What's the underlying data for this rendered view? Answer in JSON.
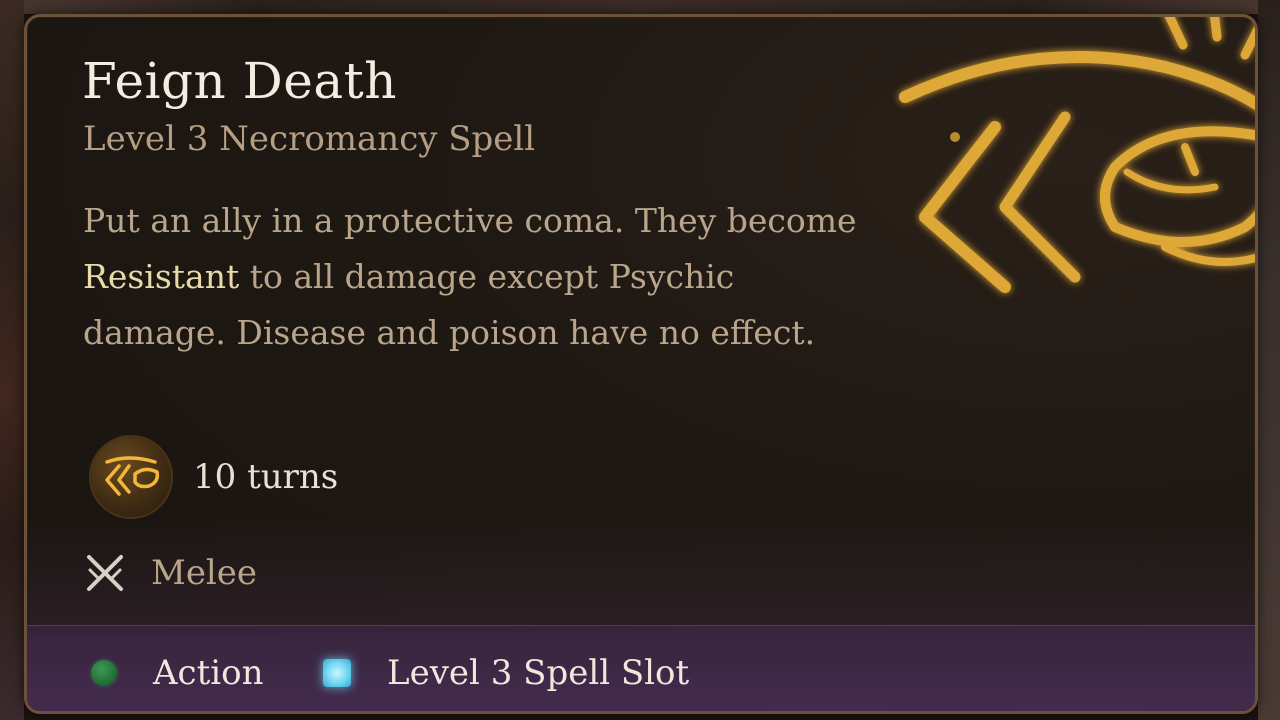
{
  "spell": {
    "name": "Feign Death",
    "subtitle": "Level 3 Necromancy Spell",
    "description": {
      "part1": "Put an ally in a protective coma. They become ",
      "keyword": "Resistant",
      "part2": " to all damage except Psychic damage. Disease and poison have no effect."
    },
    "duration": {
      "icon": "feign-death-rune-icon",
      "text": "10 turns"
    },
    "range": {
      "icon": "crossed-swords-icon",
      "text": "Melee"
    },
    "costs": [
      {
        "icon": "action-dot-icon",
        "label": "Action",
        "color": "#2e8a47"
      },
      {
        "icon": "spell-slot-square-icon",
        "label": "Level 3 Spell Slot",
        "color": "#6fd6f2"
      }
    ]
  },
  "colors": {
    "title": "#f3ece0",
    "subtitle": "#b59f84",
    "body": "#b9a58b",
    "keyword": "#e6dba8",
    "border": "#6b5238",
    "rune_glow": "#f2b73a"
  }
}
